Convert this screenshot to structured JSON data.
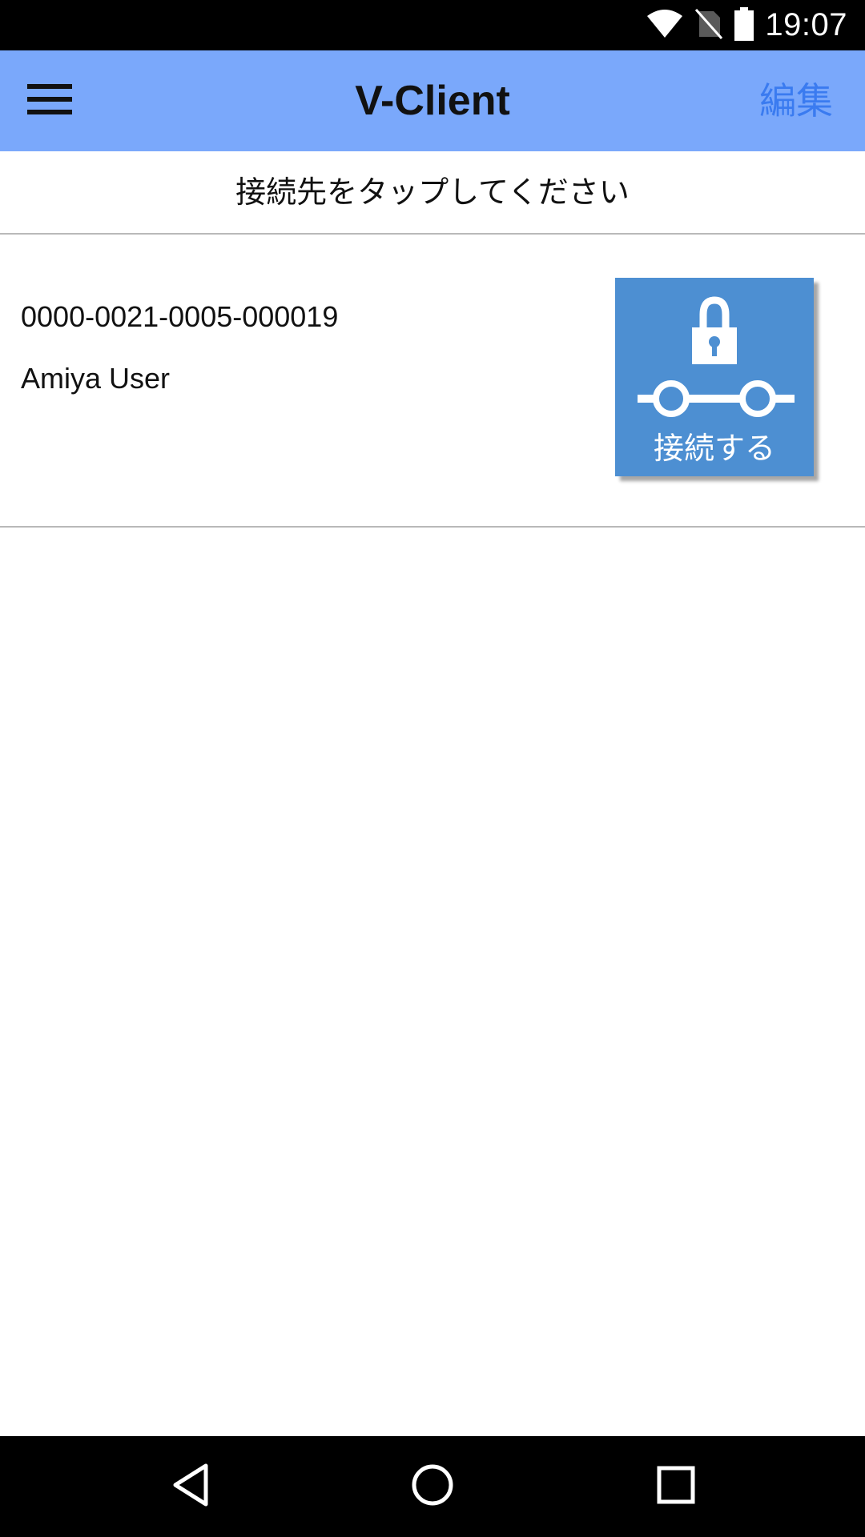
{
  "status_bar": {
    "time": "19:07",
    "icons": [
      "wifi-icon",
      "no-sim-icon",
      "battery-icon"
    ]
  },
  "app_bar": {
    "title": "V-Client",
    "menu_icon": "hamburger-menu-icon",
    "edit_label": "編集",
    "background_color": "#7aa8fb",
    "edit_color": "#3a7bf0"
  },
  "instruction": {
    "text": "接続先をタップしてください"
  },
  "connections": [
    {
      "id": "0000-0021-0005-000019",
      "user": "Amiya User",
      "connect_label": "接続する",
      "connect_icon": "lock-connection-icon",
      "button_color": "#4d8fd2"
    }
  ],
  "nav_bar": {
    "buttons": [
      "back-icon",
      "home-icon",
      "recents-icon"
    ]
  }
}
